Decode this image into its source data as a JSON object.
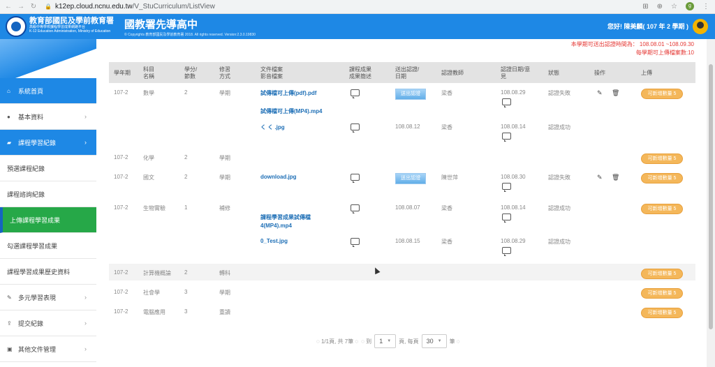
{
  "browser": {
    "url_host": "k12ep.cloud.ncnu.edu.tw",
    "url_path": "/V_StuCurriculum/ListView",
    "ext_label": "g"
  },
  "header": {
    "org_title": "教育部國民及學前教育署",
    "org_subtitle": "高級中等學校課程學習成果網路平台",
    "org_en": "K-12 Education Administration, Ministry of Education",
    "site_title": "國教署先導高中",
    "copyright": "© Copyrights 教育部國民及學前教育署 2018. All rights reserved. Version:2.3.0.19830",
    "user": "您好! 陳美麟( 107 年 2 學期 )"
  },
  "sidebar": {
    "items": [
      {
        "label": "系統首頁",
        "icon": "home-icon",
        "chevron": ""
      },
      {
        "label": "基本資料",
        "icon": "user-icon",
        "chevron": "›"
      },
      {
        "label": "課程學習紀錄",
        "icon": "book-icon",
        "chevron": "›"
      },
      {
        "label": "預選課程紀錄",
        "icon": "",
        "chevron": ""
      },
      {
        "label": "課程諮詢紀錄",
        "icon": "",
        "chevron": ""
      },
      {
        "label": "上傳課程學習成果",
        "icon": "",
        "chevron": ""
      },
      {
        "label": "勾選課程學習成果",
        "icon": "",
        "chevron": ""
      },
      {
        "label": "課程學習成果歷史資料",
        "icon": "",
        "chevron": ""
      },
      {
        "label": "多元學習表現",
        "icon": "brush-icon",
        "chevron": "›"
      },
      {
        "label": "提交紀錄",
        "icon": "upload-icon",
        "chevron": "›"
      },
      {
        "label": "其他文件管理",
        "icon": "briefcase-icon",
        "chevron": "›"
      }
    ]
  },
  "notices": {
    "line1": "本學期可送出認證時間為： 108.08.01 ~108.09.30",
    "line2": "每學期可上傳檔案數:10"
  },
  "table": {
    "headers": {
      "term": "學年期",
      "subject": "科目名稱",
      "credit": "學分/節數",
      "type": "修習方式",
      "file": "文件檔案影音檔案",
      "desc": "課程成果成果簡述",
      "sent": "送出認證/日期",
      "teacher": "認證教師",
      "verify": "認證日期/意見",
      "status": "狀態",
      "ops": "操作",
      "upload": "上傳"
    },
    "rows": [
      {
        "term": "107-2",
        "subject": "數學",
        "credit": "2",
        "type": "學期"
      },
      {
        "term": "107-2",
        "subject": "化學",
        "credit": "2",
        "type": "學期"
      },
      {
        "term": "107-2",
        "subject": "國文",
        "credit": "2",
        "type": "學期"
      },
      {
        "term": "107-2",
        "subject": "生物實驗",
        "credit": "1",
        "type": "補修"
      },
      {
        "term": "107-2",
        "subject": "計算機概論",
        "credit": "2",
        "type": "轉科"
      },
      {
        "term": "107-2",
        "subject": "社會學",
        "credit": "3",
        "type": "學期"
      },
      {
        "term": "107-2",
        "subject": "電腦應用",
        "credit": "3",
        "type": "重讀"
      }
    ],
    "files": [
      {
        "name": "試傳檔可上傳(pdf).pdf",
        "sent": "送出認證",
        "teacher": "梁香",
        "verify_date": "108.08.29",
        "status": "認證失敗"
      },
      {
        "name": "試傳檔可上傳(MP4).mp4",
        "sent": "",
        "teacher": "",
        "verify_date": "",
        "status": ""
      },
      {
        "name": "く く .jpg",
        "sent": "108.08.12",
        "teacher": "梁香",
        "verify_date": "108.08.14",
        "status": "認證成功"
      },
      {
        "name": "download.jpg",
        "sent": "送出認證",
        "teacher": "陳世萍",
        "verify_date": "108.08.30",
        "status": "認證失敗"
      },
      {
        "name": "",
        "sent": "108.08.07",
        "teacher": "梁香",
        "verify_date": "108.08.14",
        "status": "認證成功"
      },
      {
        "name": "課程學習成果試傳檔4(MP4).mp4",
        "sent": "",
        "teacher": "",
        "verify_date": "",
        "status": ""
      },
      {
        "name": "0_Test.jpg",
        "sent": "108.08.15",
        "teacher": "梁香",
        "verify_date": "108.08.29",
        "status": "認證成功"
      }
    ],
    "upload_label": "可新增數量 5"
  },
  "pager": {
    "summary": "◌ 1/1頁, 共 7筆 ◌",
    "goto": "◌ 到",
    "page": "1",
    "per_page_label": "頁, 每頁",
    "per_page": "30",
    "unit": "筆 ◌"
  }
}
